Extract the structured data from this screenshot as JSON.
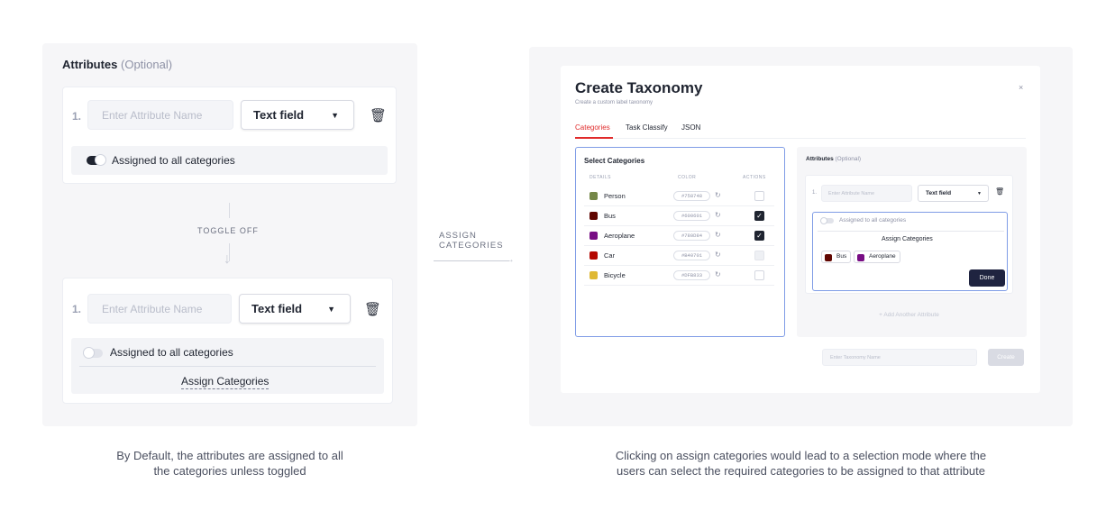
{
  "left": {
    "title": "Attributes",
    "title_optional": "(Optional)",
    "top_card": {
      "number": "1.",
      "name_placeholder": "Enter Attribute Name",
      "type": "Text field",
      "toggle_label": "Assigned to all categories",
      "toggle_on": true
    },
    "transition_label": "TOGGLE OFF",
    "bottom_card": {
      "number": "1.",
      "name_placeholder": "Enter Attribute Name",
      "type": "Text field",
      "toggle_label": "Assigned to all categories",
      "toggle_on": false,
      "assign_link": "Assign Categories"
    },
    "caption_line1": "By Default, the attributes are assigned to all",
    "caption_line2": "the categories unless toggled"
  },
  "middle": {
    "label_line1": "ASSIGN",
    "label_line2": "CATEGORIES"
  },
  "right": {
    "modal": {
      "title": "Create Taxonomy",
      "subtitle": "Create a custom label taxonomy",
      "close": "×",
      "tabs": [
        {
          "label": "Categories",
          "active": true
        },
        {
          "label": "Task Classify",
          "active": false
        },
        {
          "label": "JSON",
          "active": false
        }
      ],
      "categories": {
        "title": "Select Categories",
        "headers": [
          "DETAILS",
          "COLOR",
          "ACTIONS"
        ],
        "rows": [
          {
            "name": "Person",
            "color": "#758748",
            "hex": "#758748",
            "checked": false,
            "disabled": false
          },
          {
            "name": "Bus",
            "color": "#600601",
            "hex": "#600601",
            "checked": true,
            "disabled": false
          },
          {
            "name": "Aeroplane",
            "color": "#780D84",
            "hex": "#780D84",
            "checked": true,
            "disabled": false
          },
          {
            "name": "Car",
            "color": "#B40701",
            "hex": "#B40701",
            "checked": false,
            "disabled": true
          },
          {
            "name": "Bicycle",
            "color": "#DFB833",
            "hex": "#DFB833",
            "checked": false,
            "disabled": false
          }
        ]
      },
      "attributes": {
        "title": "Attributes",
        "title_optional": "(Optional)",
        "number": "1.",
        "name_placeholder": "Enter Attribute Name",
        "type": "Text field",
        "toggle_label": "Assigned to all categories",
        "assign_link": "Assign Categories",
        "chips": [
          {
            "label": "Bus",
            "color": "#600601"
          },
          {
            "label": "Aeroplane",
            "color": "#780D84"
          }
        ],
        "done": "Done",
        "add_another": "+  Add Another Attribute"
      },
      "taxonomy_name_placeholder": "Enter Taxonomy Name",
      "create": "Create"
    },
    "caption_line1": "Clicking on assign categories would lead to a selection mode where the",
    "caption_line2": "users can select the required categories to be assigned to that attribute"
  }
}
